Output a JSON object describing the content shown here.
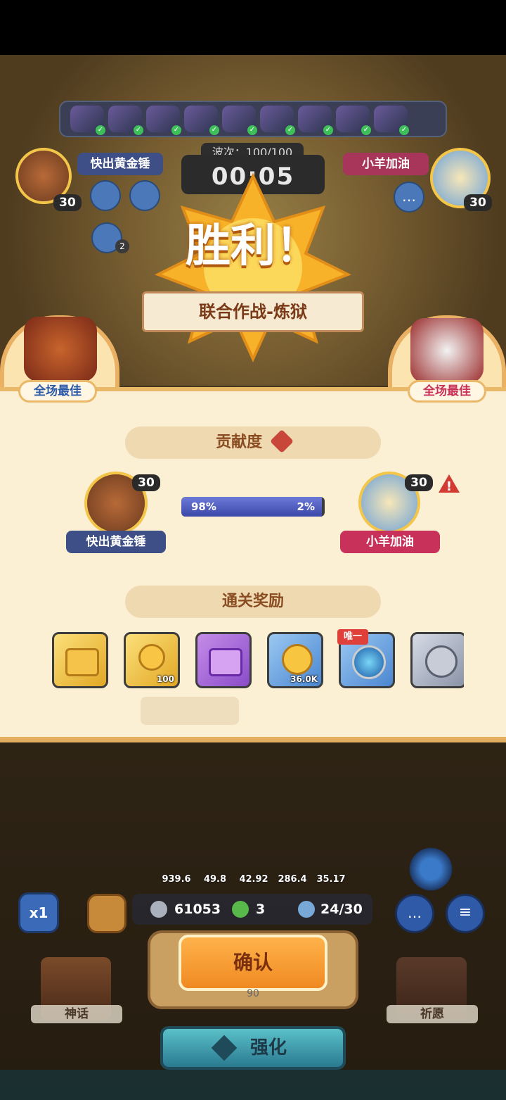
{
  "header": {
    "wave_label": "波次：100/100",
    "timer": "00:05"
  },
  "players": {
    "left": {
      "name": "快出黄金锤",
      "level": "30"
    },
    "right": {
      "name": "小羊加油",
      "level": "30"
    }
  },
  "notification_count": "2",
  "victory": {
    "title": "胜利！",
    "subtitle": "联合作战-炼狱",
    "mvp_left": "全场最佳",
    "mvp_right": "全场最佳"
  },
  "contribution": {
    "title": "贡献度",
    "left_percent_label": "98%",
    "right_percent_label": "2%",
    "left_fraction": 0.98
  },
  "rewards": {
    "title": "通关奖励",
    "items": [
      {
        "icon": "gold-chest-icon",
        "qty": "",
        "tag": ""
      },
      {
        "icon": "gold-key-icon",
        "qty": "100",
        "tag": ""
      },
      {
        "icon": "purple-chest-icon",
        "qty": "",
        "tag": ""
      },
      {
        "icon": "gold-coin-icon",
        "qty": "36.0K",
        "tag": ""
      },
      {
        "icon": "blue-emblem-icon",
        "qty": "",
        "tag": "唯一"
      },
      {
        "icon": "silver-coin-icon",
        "qty": "",
        "tag": ""
      }
    ]
  },
  "stats": [
    "939.6",
    "49.8",
    "42.92",
    "286.4",
    "35.17"
  ],
  "resources": {
    "silver": "61053",
    "clover": "3",
    "units": "24/30"
  },
  "buttons": {
    "speed": "x1",
    "confirm": "确认",
    "myth": "神话",
    "wish": "祈愿",
    "upgrade": "强化",
    "hidden_cost": "90"
  }
}
